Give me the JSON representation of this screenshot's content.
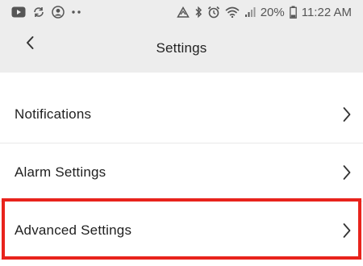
{
  "status_bar": {
    "battery": "20%",
    "time": "11:22 AM",
    "left_icons": [
      "youtube-icon",
      "sync-icon",
      "account-icon",
      "more-dots-icon"
    ],
    "right_icons": [
      "recycle-icon",
      "bluetooth-icon",
      "alarm-icon",
      "wifi-icon",
      "signal-icon",
      "battery-icon"
    ]
  },
  "header": {
    "title": "Settings",
    "back_icon": "chevron-left-icon"
  },
  "settings": {
    "items": [
      {
        "label": "Notifications",
        "icon": "chevron-right-icon"
      },
      {
        "label": "Alarm Settings",
        "icon": "chevron-right-icon"
      },
      {
        "label": "Advanced Settings",
        "icon": "chevron-right-icon",
        "highlighted": true
      }
    ]
  },
  "colors": {
    "header_bg": "#ededed",
    "highlight": "#e8231c",
    "text": "#1f1f1f"
  }
}
